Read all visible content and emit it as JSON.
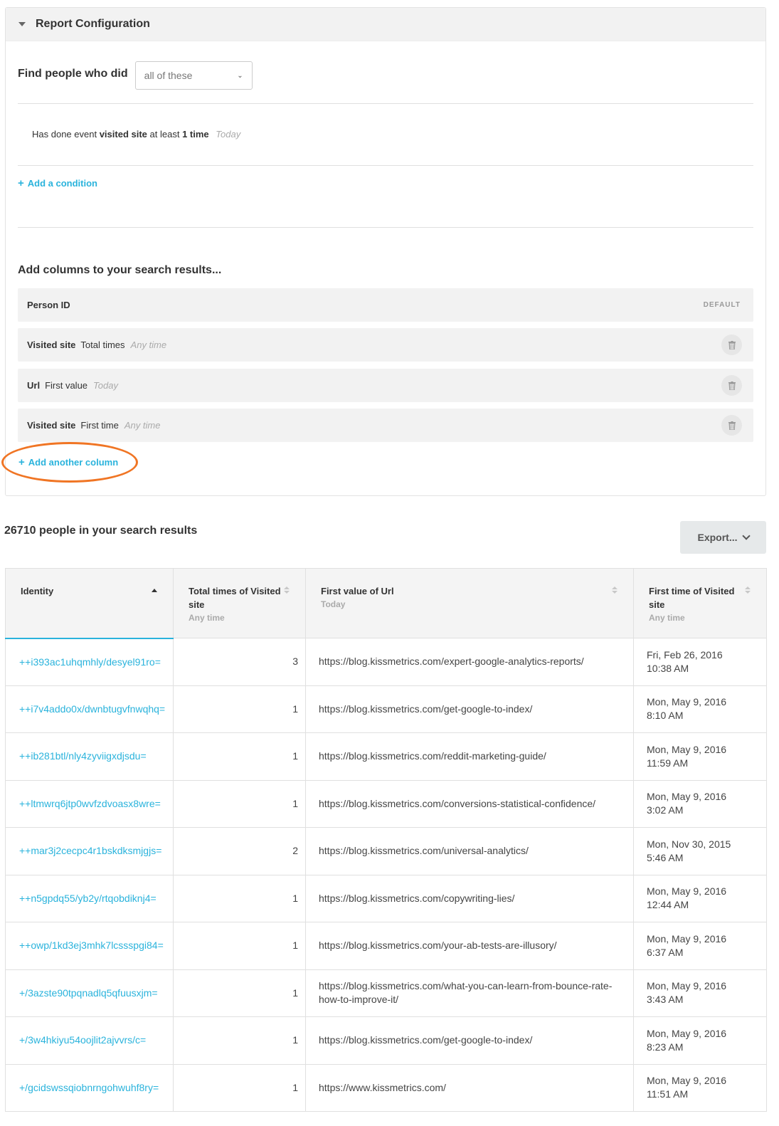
{
  "config": {
    "title": "Report Configuration",
    "find_label": "Find people who did",
    "match_select": "all of these",
    "condition": {
      "prefix": "Has done event",
      "event": "visited site",
      "middle": "at least",
      "count": "1 time",
      "timeframe": "Today"
    },
    "add_condition": "Add a condition",
    "columns_title": "Add columns to your search results...",
    "columns": [
      {
        "name": "Person ID",
        "tag": "DEFAULT"
      },
      {
        "name": "Visited site",
        "measure": "Total times",
        "timeframe": "Any time"
      },
      {
        "name": "Url",
        "measure": "First value",
        "timeframe": "Today"
      },
      {
        "name": "Visited site",
        "measure": "First time",
        "timeframe": "Any time"
      }
    ],
    "add_column": "Add another column"
  },
  "results": {
    "count_text": "26710 people in your search results",
    "export_label": "Export...",
    "headers": [
      {
        "label": "Identity"
      },
      {
        "label": "Total times of Visited site",
        "sub": "Any time"
      },
      {
        "label": "First value of Url",
        "sub": "Today"
      },
      {
        "label": "First time of Visited site",
        "sub": "Any time"
      }
    ],
    "rows": [
      {
        "identity": "++i393ac1uhqmhly/desyel91ro=",
        "times": "3",
        "url": "https://blog.kissmetrics.com/expert-google-analytics-reports/",
        "date": "Fri, Feb 26, 2016",
        "time": "10:38 AM"
      },
      {
        "identity": "++i7v4addo0x/dwnbtugvfnwqhq=",
        "times": "1",
        "url": "https://blog.kissmetrics.com/get-google-to-index/",
        "date": "Mon, May 9, 2016",
        "time": "8:10 AM"
      },
      {
        "identity": "++ib281btl/nly4zyviigxdjsdu=",
        "times": "1",
        "url": "https://blog.kissmetrics.com/reddit-marketing-guide/",
        "date": "Mon, May 9, 2016",
        "time": "11:59 AM"
      },
      {
        "identity": "++ltmwrq6jtp0wvfzdvoasx8wre=",
        "times": "1",
        "url": "https://blog.kissmetrics.com/conversions-statistical-confidence/",
        "date": "Mon, May 9, 2016",
        "time": "3:02 AM"
      },
      {
        "identity": "++mar3j2cecpc4r1bskdksmjgjs=",
        "times": "2",
        "url": "https://blog.kissmetrics.com/universal-analytics/",
        "date": "Mon, Nov 30, 2015",
        "time": "5:46 AM"
      },
      {
        "identity": "++n5gpdq55/yb2y/rtqobdiknj4=",
        "times": "1",
        "url": "https://blog.kissmetrics.com/copywriting-lies/",
        "date": "Mon, May 9, 2016",
        "time": "12:44 AM"
      },
      {
        "identity": "++owp/1kd3ej3mhk7lcssspgi84=",
        "times": "1",
        "url": "https://blog.kissmetrics.com/your-ab-tests-are-illusory/",
        "date": "Mon, May 9, 2016",
        "time": "6:37 AM"
      },
      {
        "identity": "+/3azste90tpqnadlq5qfuusxjm=",
        "times": "1",
        "url": "https://blog.kissmetrics.com/what-you-can-learn-from-bounce-rate-how-to-improve-it/",
        "date": "Mon, May 9, 2016",
        "time": "3:43 AM"
      },
      {
        "identity": "+/3w4hkiyu54oojlit2ajvvrs/c=",
        "times": "1",
        "url": "https://blog.kissmetrics.com/get-google-to-index/",
        "date": "Mon, May 9, 2016",
        "time": "8:23 AM"
      },
      {
        "identity": "+/gcidswssqiobnrngohwuhf8ry=",
        "times": "1",
        "url": "https://www.kissmetrics.com/",
        "date": "Mon, May 9, 2016",
        "time": "11:51 AM"
      }
    ]
  },
  "colors": {
    "accent": "#2ab3dc",
    "highlight": "#f07524",
    "panel_bg": "#f2f2f2"
  },
  "icons": {
    "collapse": "caret-down-icon",
    "remove_column": "trash-icon",
    "add": "plus-icon",
    "sort_asc": "sort-ascending-icon",
    "sort": "sort-icon",
    "export": "chevron-down-icon"
  }
}
